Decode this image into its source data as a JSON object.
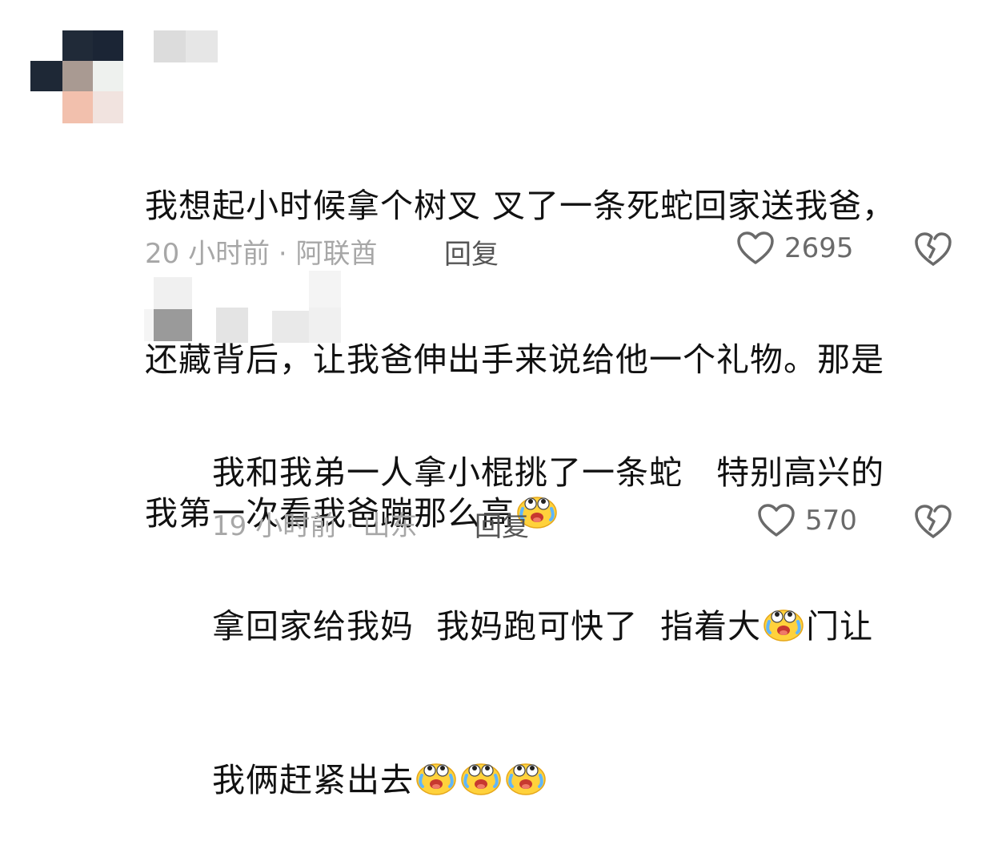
{
  "comments": [
    {
      "lines": [
        "我想起小时候拿个树叉 叉了一条死蛇回家送我爸，",
        "还藏背后，让我爸伸出手来说给他一个礼物。那是",
        "我第一次看我爸蹦那么高"
      ],
      "meta": "20 小时前 · 阿联酋",
      "reply_label": "回复",
      "likes": "2695"
    },
    {
      "lines": [
        "我和我弟一人拿小棍挑了一条蛇   特别高兴的",
        "拿回家给我妈  我妈跑可快了  指着大",
        "门让",
        "我俩赶紧出去"
      ],
      "meta": "19 小时前 · 山东",
      "reply_label": "回复",
      "likes": "570"
    }
  ],
  "icons": {
    "like": "heart-outline-icon",
    "dislike": "broken-heart-icon",
    "emoji": "laugh-cry-emoji-icon"
  }
}
